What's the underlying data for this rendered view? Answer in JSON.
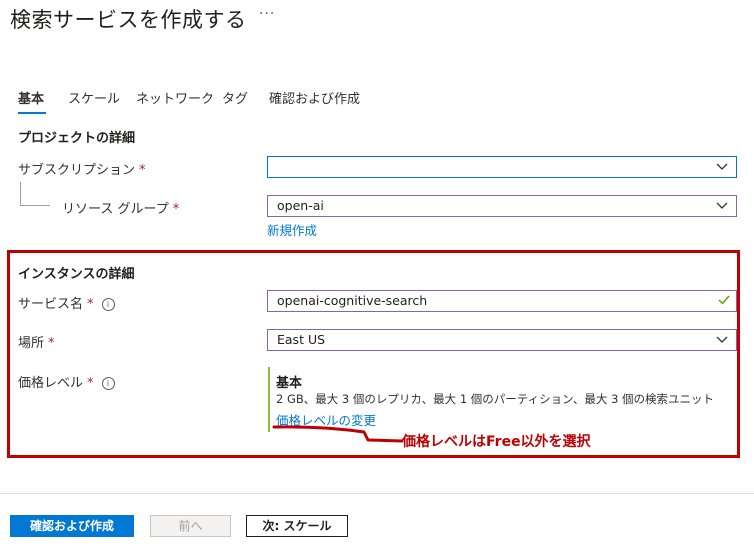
{
  "page": {
    "title": "検索サービスを作成する",
    "more_label": "···"
  },
  "tabs": [
    {
      "label": "基本"
    },
    {
      "label": "スケール"
    },
    {
      "label": "ネットワーク"
    },
    {
      "label": "タグ"
    },
    {
      "label": "確認および作成"
    }
  ],
  "project": {
    "section_title": "プロジェクトの詳細",
    "subscription_label": "サブスクリプション",
    "subscription_value": "",
    "resource_group_label": "リソース グループ",
    "resource_group_value": "open-ai",
    "create_new_label": "新規作成"
  },
  "instance": {
    "section_title": "インスタンスの詳細",
    "service_name_label": "サービス名",
    "service_name_value": "openai-cognitive-search",
    "location_label": "場所",
    "location_value": "East US",
    "pricing_label": "価格レベル",
    "pricing_tier_name": "基本",
    "pricing_tier_desc": "2 GB、最大 3 個のレプリカ、最大 1 個のパーティション、最大 3 個の検索ユニット",
    "pricing_change_label": "価格レベルの変更"
  },
  "required_marker": "*",
  "info_glyph": "i",
  "annotation": {
    "text": "価格レベルはFree以外を選択",
    "color": "#c00000"
  },
  "footer": {
    "review_create_label": "確認および作成",
    "previous_label": "前へ",
    "next_label": "次: スケール"
  },
  "colors": {
    "accent": "#0078d4",
    "highlight_border": "#c00000",
    "tier_bar": "#86c13d",
    "valid_check": "#57a300"
  }
}
